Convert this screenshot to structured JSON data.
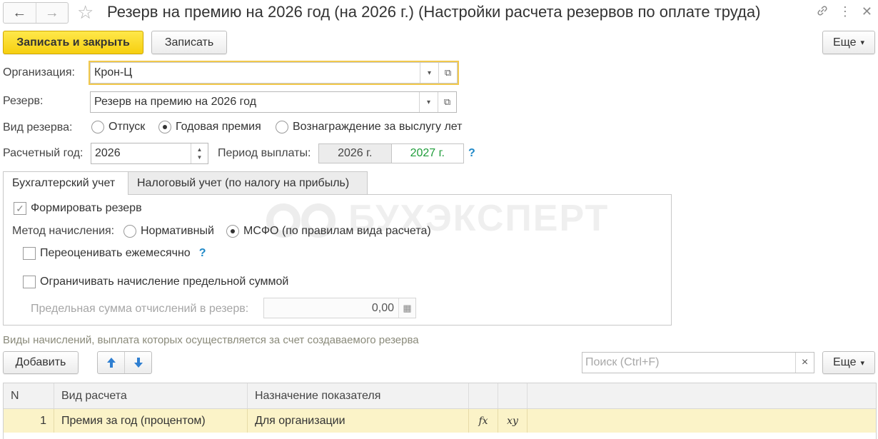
{
  "window": {
    "title": "Резерв на премию на 2026 год (на 2026 г.) (Настройки расчета резервов по оплате труда)",
    "back_icon": "←",
    "forward_icon": "→",
    "star_icon": "☆",
    "link_icon": "🔗",
    "menu_icon": "⋮",
    "close_icon": "✕"
  },
  "toolbar": {
    "save_close_label": "Записать и закрыть",
    "save_label": "Записать",
    "more_label": "Еще",
    "more_arrow": "▾"
  },
  "form": {
    "org_label": "Организация:",
    "org_value": "Крон-Ц",
    "reserve_label": "Резерв:",
    "reserve_value": "Резерв на премию на 2026 год",
    "dropdown_icon": "▾",
    "open_icon": "⧉",
    "kind_label": "Вид резерва:",
    "kind_options": [
      "Отпуск",
      "Годовая премия",
      "Вознаграждение за выслугу лет"
    ],
    "kind_selected": 1,
    "year_label": "Расчетный год:",
    "year_value": "2026",
    "period_label": "Период выплаты:",
    "period_from": "2026 г.",
    "period_to": "2027 г.",
    "help_mark": "?"
  },
  "tabs": {
    "items": [
      "Бухгалтерский учет",
      "Налоговый учет (по налогу на прибыль)"
    ],
    "active": 0
  },
  "accounting": {
    "form_reserve_label": "Формировать резерв",
    "form_reserve_checked": true,
    "check_mark": "✓",
    "method_label": "Метод начисления:",
    "method_options": [
      "Нормативный",
      "МСФО (по правилам вида расчета)"
    ],
    "method_selected": 1,
    "revalue_label": "Переоценивать ежемесячно",
    "revalue_checked": false,
    "limit_label": "Ограничивать начисление предельной суммой",
    "limit_checked": false,
    "max_sum_label": "Предельная сумма отчислений в резерв:",
    "max_sum_value": "0,00",
    "calc_icon": "▦",
    "help_mark": "?"
  },
  "watermark": "БУХЭКСПЕРТ",
  "accruals": {
    "caption": "Виды начислений, выплата которых осуществляется за счет создаваемого резерва",
    "add_label": "Добавить",
    "up_icon": "↑",
    "down_icon": "↓",
    "search_placeholder": "Поиск (Ctrl+F)",
    "clear_icon": "×",
    "more_label": "Еще",
    "more_arrow": "▾",
    "columns": [
      "N",
      "Вид расчета",
      "Назначение показателя",
      "",
      "",
      ""
    ],
    "rows": [
      {
        "n": "1",
        "kind": "Премия за год (процентом)",
        "purpose": "Для организации",
        "fx": "fx",
        "xy": "xy"
      }
    ]
  },
  "colors": {
    "primary_button": "#f6cf10",
    "focus_border": "#f2c94c",
    "accent_green": "#1f9d3a",
    "help_blue": "#1e88c7",
    "selected_row": "#fbf3c8",
    "arrow_blue": "#2f7fd1"
  }
}
